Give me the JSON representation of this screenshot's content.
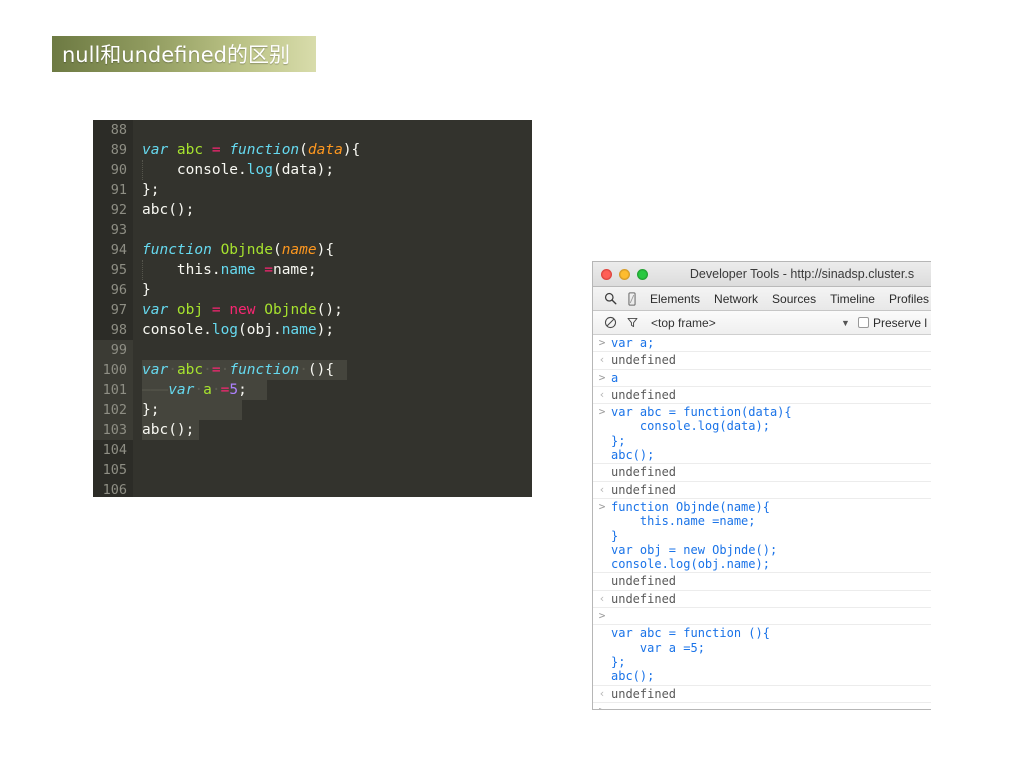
{
  "slide": {
    "title": "null和undefined的区别"
  },
  "editor": {
    "lines": [
      {
        "num": "88",
        "selected": false,
        "tokens": []
      },
      {
        "num": "89",
        "selected": false,
        "tokens": [
          {
            "t": "var ",
            "c": "kw"
          },
          {
            "t": "abc",
            "c": "fn"
          },
          {
            "t": " ",
            "c": "plain"
          },
          {
            "t": "=",
            "c": "op"
          },
          {
            "t": " ",
            "c": "plain"
          },
          {
            "t": "function",
            "c": "kw"
          },
          {
            "t": "(",
            "c": "plain"
          },
          {
            "t": "data",
            "c": "param"
          },
          {
            "t": "){",
            "c": "plain"
          }
        ]
      },
      {
        "num": "90",
        "selected": false,
        "guide": true,
        "tokens": [
          {
            "t": "    ",
            "c": "plain"
          },
          {
            "t": "console",
            "c": "plain"
          },
          {
            "t": ".",
            "c": "dot"
          },
          {
            "t": "log",
            "c": "prop"
          },
          {
            "t": "(data);",
            "c": "plain"
          }
        ]
      },
      {
        "num": "91",
        "selected": false,
        "tokens": [
          {
            "t": "};",
            "c": "plain"
          }
        ]
      },
      {
        "num": "92",
        "selected": false,
        "tokens": [
          {
            "t": "abc();",
            "c": "plain"
          }
        ]
      },
      {
        "num": "93",
        "selected": false,
        "tokens": []
      },
      {
        "num": "94",
        "selected": false,
        "tokens": [
          {
            "t": "function ",
            "c": "kw"
          },
          {
            "t": "Objnde",
            "c": "fn"
          },
          {
            "t": "(",
            "c": "plain"
          },
          {
            "t": "name",
            "c": "param"
          },
          {
            "t": "){",
            "c": "plain"
          }
        ]
      },
      {
        "num": "95",
        "selected": false,
        "guide": true,
        "tokens": [
          {
            "t": "    ",
            "c": "plain"
          },
          {
            "t": "this",
            "c": "plain"
          },
          {
            "t": ".",
            "c": "dot"
          },
          {
            "t": "name",
            "c": "prop"
          },
          {
            "t": " ",
            "c": "plain"
          },
          {
            "t": "=",
            "c": "op"
          },
          {
            "t": "name;",
            "c": "plain"
          }
        ]
      },
      {
        "num": "96",
        "selected": false,
        "tokens": [
          {
            "t": "}",
            "c": "plain"
          }
        ]
      },
      {
        "num": "97",
        "selected": false,
        "tokens": [
          {
            "t": "var ",
            "c": "kw"
          },
          {
            "t": "obj",
            "c": "fn"
          },
          {
            "t": " ",
            "c": "plain"
          },
          {
            "t": "=",
            "c": "op"
          },
          {
            "t": " ",
            "c": "plain"
          },
          {
            "t": "new",
            "c": "op"
          },
          {
            "t": " ",
            "c": "plain"
          },
          {
            "t": "Objnde",
            "c": "fn"
          },
          {
            "t": "();",
            "c": "plain"
          }
        ]
      },
      {
        "num": "98",
        "selected": false,
        "tokens": [
          {
            "t": "console",
            "c": "plain"
          },
          {
            "t": ".",
            "c": "dot"
          },
          {
            "t": "log",
            "c": "prop"
          },
          {
            "t": "(obj",
            "c": "plain"
          },
          {
            "t": ".",
            "c": "dot"
          },
          {
            "t": "name",
            "c": "prop"
          },
          {
            "t": ");",
            "c": "plain"
          }
        ]
      },
      {
        "num": "99",
        "selected": true,
        "selWidth": 14,
        "tokens": []
      },
      {
        "num": "100",
        "selected": true,
        "selWidth": 205,
        "tokens": [
          {
            "t": "var",
            "c": "kw"
          },
          {
            "t": "·",
            "c": "ws"
          },
          {
            "t": "abc",
            "c": "fn"
          },
          {
            "t": "·",
            "c": "ws"
          },
          {
            "t": "=",
            "c": "op"
          },
          {
            "t": "·",
            "c": "ws"
          },
          {
            "t": "function",
            "c": "kw"
          },
          {
            "t": "·",
            "c": "ws"
          },
          {
            "t": "(){",
            "c": "plain"
          }
        ]
      },
      {
        "num": "101",
        "selected": true,
        "selWidth": 125,
        "tokens": [
          {
            "t": "———",
            "c": "tabmark"
          },
          {
            "t": "var",
            "c": "kw"
          },
          {
            "t": "·",
            "c": "ws"
          },
          {
            "t": "a",
            "c": "fn"
          },
          {
            "t": "·",
            "c": "ws"
          },
          {
            "t": "=",
            "c": "op"
          },
          {
            "t": "5",
            "c": "num"
          },
          {
            "t": ";",
            "c": "plain"
          }
        ]
      },
      {
        "num": "102",
        "selected": true,
        "selWidth": 100,
        "tokens": [
          {
            "t": "};",
            "c": "plain"
          }
        ]
      },
      {
        "num": "103",
        "selected": true,
        "selWidth": 57,
        "tokens": [
          {
            "t": "abc();",
            "c": "plain"
          }
        ]
      },
      {
        "num": "104",
        "selected": false,
        "tokens": []
      },
      {
        "num": "105",
        "selected": false,
        "tokens": []
      },
      {
        "num": "106",
        "selected": false,
        "tokens": []
      }
    ]
  },
  "devtools": {
    "window_title": "Developer Tools - http://sinadsp.cluster.s",
    "toolbar_icons": [
      "search-icon",
      "device-toggle-icon"
    ],
    "tabs": [
      "Elements",
      "Network",
      "Sources",
      "Timeline",
      "Profiles"
    ],
    "filterbar": {
      "clear_icon": "clear-console-icon",
      "filter_icon": "filter-funnel-icon",
      "frame_selector": "<top frame>",
      "caret": "▼",
      "preserve_log_label": "Preserve l",
      "preserve_log_checked": false
    },
    "console": [
      {
        "kind": "input",
        "marker": ">",
        "text": "var a;"
      },
      {
        "kind": "output",
        "marker": "‹",
        "text": "undefined"
      },
      {
        "kind": "input",
        "marker": ">",
        "text": "a"
      },
      {
        "kind": "output",
        "marker": "‹",
        "text": "undefined"
      },
      {
        "kind": "input",
        "marker": ">",
        "text": "var abc = function(data){\n    console.log(data);\n};\nabc();"
      },
      {
        "kind": "output",
        "marker": "",
        "text": "undefined"
      },
      {
        "kind": "output",
        "marker": "‹",
        "text": "undefined"
      },
      {
        "kind": "input",
        "marker": ">",
        "text": "function Objnde(name){\n    this.name =name;\n}\nvar obj = new Objnde();\nconsole.log(obj.name);"
      },
      {
        "kind": "output",
        "marker": "",
        "text": "undefined"
      },
      {
        "kind": "output",
        "marker": "‹",
        "text": "undefined"
      },
      {
        "kind": "input",
        "marker": ">",
        "text": ""
      },
      {
        "kind": "input",
        "marker": "",
        "text": "var abc = function (){\n    var a =5;\n};\nabc();"
      },
      {
        "kind": "output",
        "marker": "‹",
        "text": "undefined"
      },
      {
        "kind": "input",
        "marker": ">",
        "text": ""
      }
    ]
  }
}
